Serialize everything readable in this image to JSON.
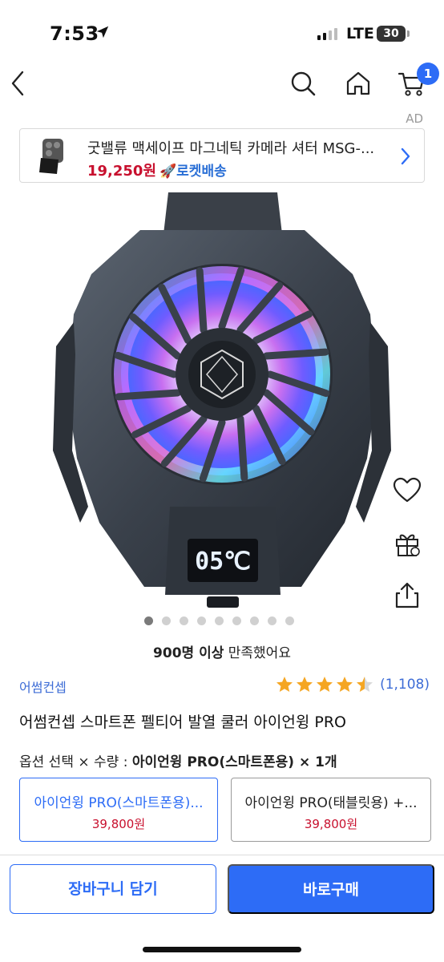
{
  "status_bar": {
    "time": "7:53",
    "network": "LTE",
    "battery": "30"
  },
  "nav": {
    "cart_count": "1",
    "ad_label": "AD"
  },
  "ad_banner": {
    "title": "굿밸류 맥세이프 마그네틱 카메라 셔터 MSG-...",
    "price": "19,250원",
    "rocket_label": "🚀로켓배송"
  },
  "gallery": {
    "display_reading": "05℃",
    "dot_count": 9,
    "active_dot": 0
  },
  "satisfaction": {
    "count_text": "900명 이상",
    "suffix_text": " 만족했어요"
  },
  "product": {
    "brand": "어썸컨셉",
    "rating": 4.5,
    "review_count": "(1,108)",
    "name": "어썸컨셉 스마트폰 펠티어 발열 쿨러 아이언윙 PRO"
  },
  "options": {
    "label": "옵션 선택 × 수량 : ",
    "selected_summary": "아이언윙 PRO(스마트폰용) × 1개",
    "items": [
      {
        "name": "아이언윙 PRO(스마트폰용)...",
        "price": "39,800원",
        "selected": true
      },
      {
        "name": "아이언윙 PRO(태블릿용) +...",
        "price": "39,800원",
        "selected": false
      }
    ]
  },
  "actions": {
    "add_to_cart": "장바구니 담기",
    "buy_now": "바로구매"
  },
  "colors": {
    "accent": "#2d6cf6",
    "price_red": "#c8102e",
    "star": "#f5a623"
  }
}
